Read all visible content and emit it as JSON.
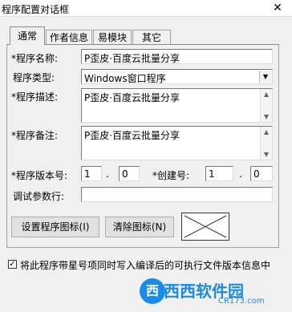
{
  "window": {
    "title": "程序配置对话框",
    "close_glyph": "✕"
  },
  "tabs": [
    {
      "label": "通常",
      "active": true
    },
    {
      "label": "作者信息",
      "active": false
    },
    {
      "label": "易模块",
      "active": false
    },
    {
      "label": "其它",
      "active": false
    }
  ],
  "form": {
    "program_name_label": "*程序名称:",
    "program_name_value": "P歪皮·百度云批量分享",
    "program_type_label": "程序类型:",
    "program_type_value": "Windows窗口程序",
    "description_label": "*程序描述:",
    "description_value": "P歪皮·百度云批量分享",
    "remarks_label": "*程序备注:",
    "remarks_value": "P歪皮·百度云批量分享",
    "version_label": "*程序版本号:",
    "version_major": "1",
    "version_dot1": ".",
    "version_minor": "0",
    "build_label": "*创建号:",
    "build_major": "1",
    "build_dot": ".",
    "build_minor": "0",
    "debug_params_label": "调试参数行:",
    "debug_params_value": ""
  },
  "buttons": {
    "set_icon": "设置程序图标(I)",
    "clear_icon": "清除图标(N)"
  },
  "checkbox": {
    "checked": true,
    "check_glyph": "✓",
    "label": "将此程序带星号项同时写入编译后的可执行文件版本信息中"
  },
  "watermark": {
    "logo_glyph": "西",
    "text": "西西软件园",
    "site": "CR173.com"
  }
}
